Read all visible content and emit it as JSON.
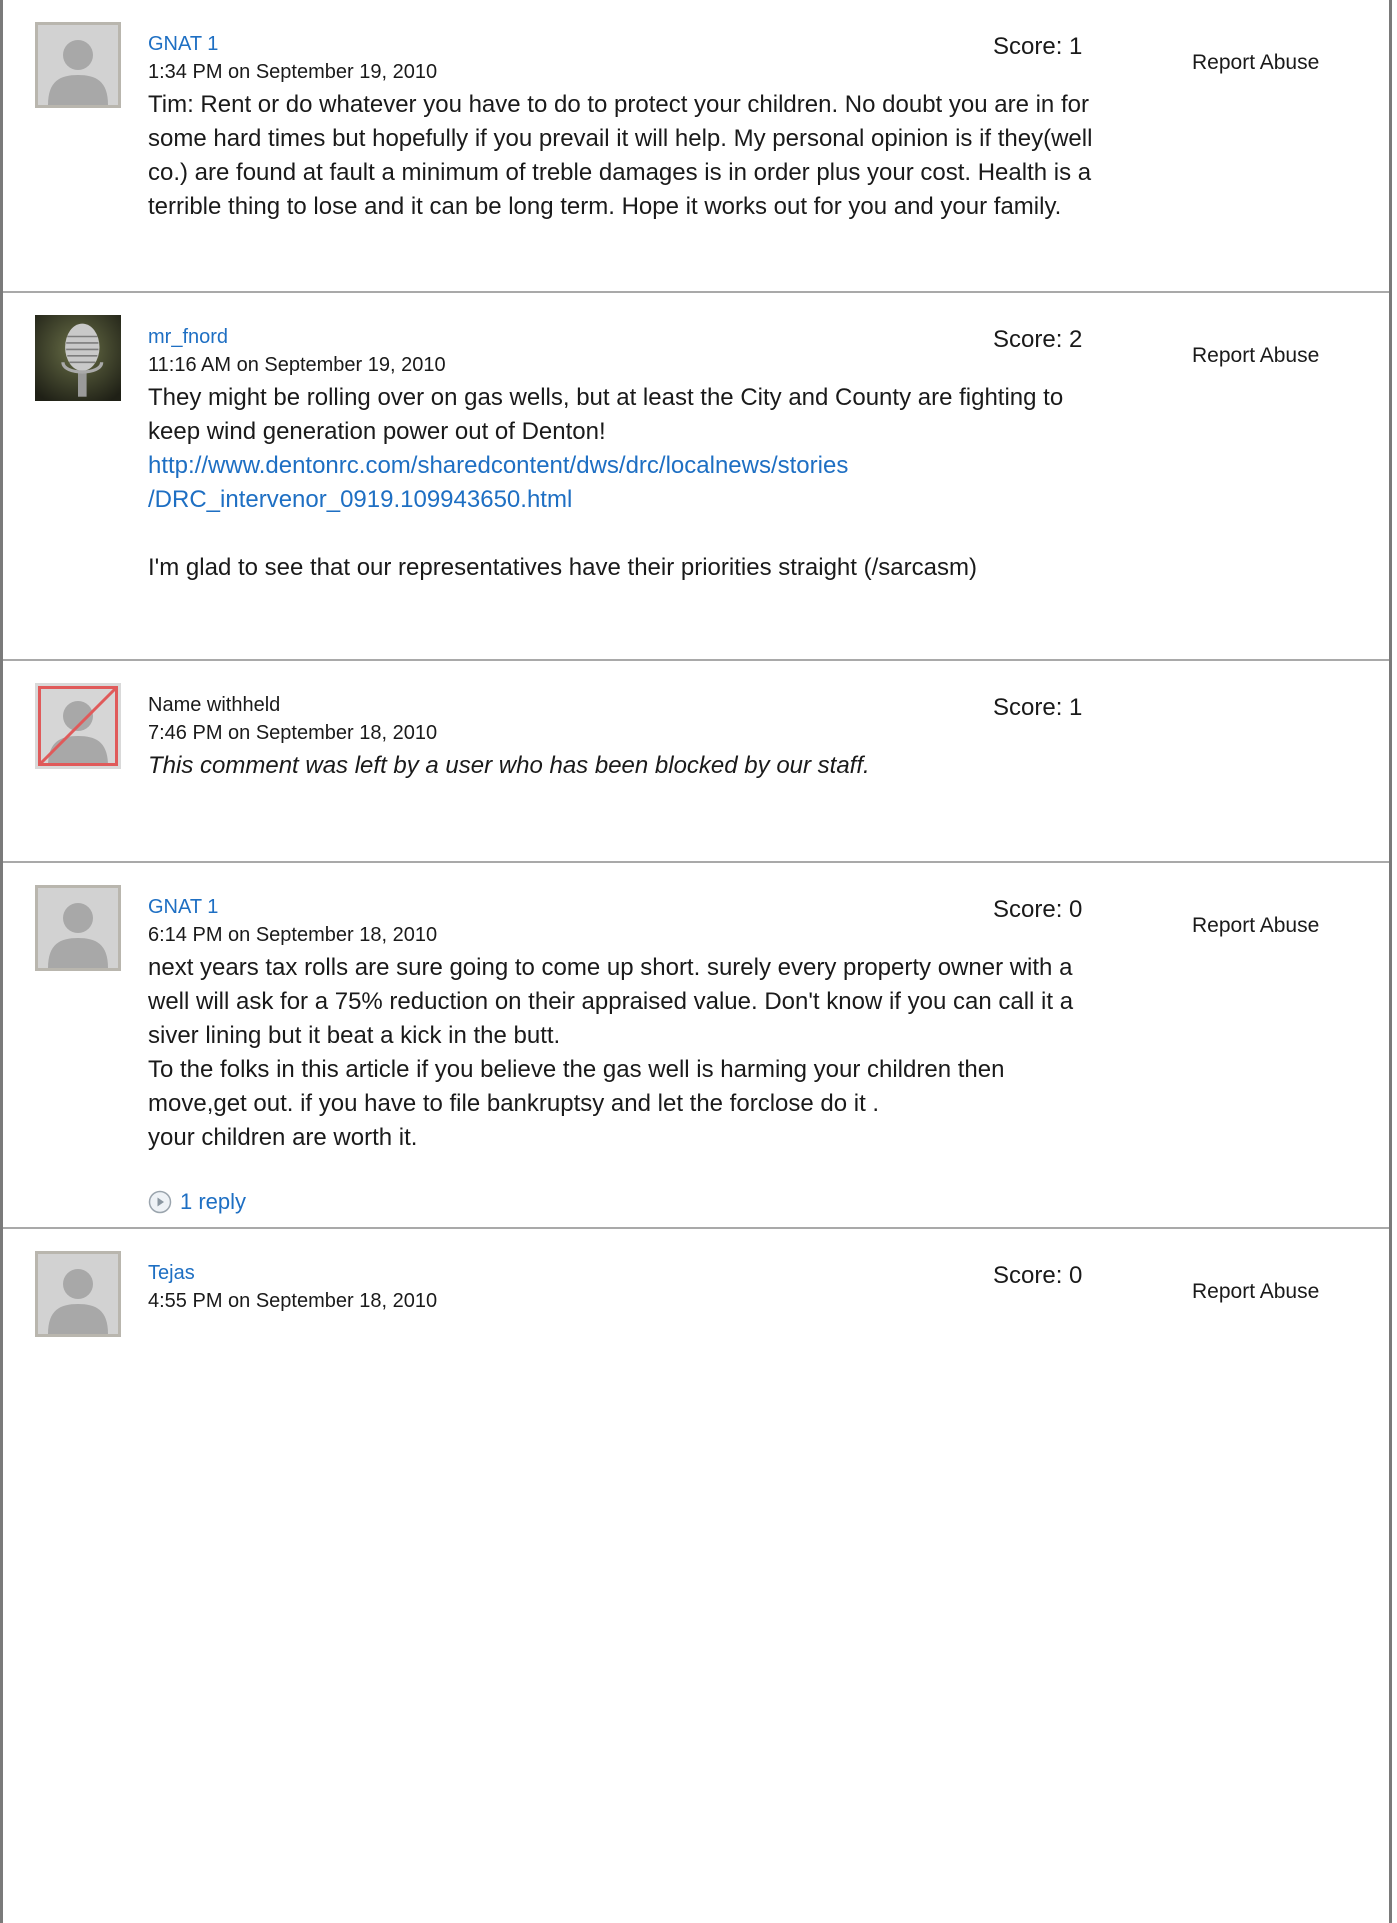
{
  "comments": [
    {
      "author": "GNAT 1",
      "author_linked": true,
      "date": "1:34 PM on September 19, 2010",
      "score": "Score: 1",
      "report": "Report Abuse",
      "text": "Tim: Rent or do whatever you have to do to protect your children. No doubt you are in for some hard times but hopefully if you prevail it will help. My personal opinion is if they(well co.) are found at fault a minimum of treble damages is in order plus your cost. Health is a terrible thing to lose and it can be long term. Hope it works out for you and your family."
    },
    {
      "author": "mr_fnord",
      "author_linked": true,
      "date": "11:16 AM on September 19, 2010",
      "score": "Score: 2",
      "report": "Report Abuse",
      "text_before": "They might be rolling over on gas wells, but at least the City and County are fighting to keep wind generation power out of Denton!",
      "link_line1": "http://www.dentonrc.com/sharedcontent/dws/drc/localnews/stories",
      "link_line2": "/DRC_intervenor_0919.109943650.html",
      "text_after": "I'm glad to see that our representatives have their priorities straight (/sarcasm)"
    },
    {
      "author": "Name withheld",
      "author_linked": false,
      "date": "7:46 PM on September 18, 2010",
      "score": "Score: 1",
      "text": "This comment was left by a user who has been blocked by our staff."
    },
    {
      "author": "GNAT 1",
      "author_linked": true,
      "date": "6:14 PM on September 18, 2010",
      "score": "Score: 0",
      "report": "Report Abuse",
      "text": "next years tax rolls are sure going to come up short. surely every property owner with a well will ask for a 75% reduction on their appraised value. Don't know if you can call it a siver lining but it beat a kick in the butt.\nTo the folks in this article if you believe the gas well is harming your children then move,get out. if you have to file bankruptsy and let the forclose do it .\nyour children are worth it.",
      "replies": "1 reply"
    },
    {
      "author": "Tejas",
      "author_linked": true,
      "date": "4:55 PM on September 18, 2010",
      "score": "Score: 0",
      "report": "Report Abuse"
    }
  ],
  "icons": {
    "avatar_default": "default-user-silhouette-icon",
    "avatar_mic": "microphone-avatar",
    "avatar_blocked": "blocked-user-icon",
    "reply": "play-circle-icon"
  },
  "colors": {
    "link": "#1e6fc3",
    "divider": "#a9a9a9",
    "blocked": "#e05a5a"
  }
}
